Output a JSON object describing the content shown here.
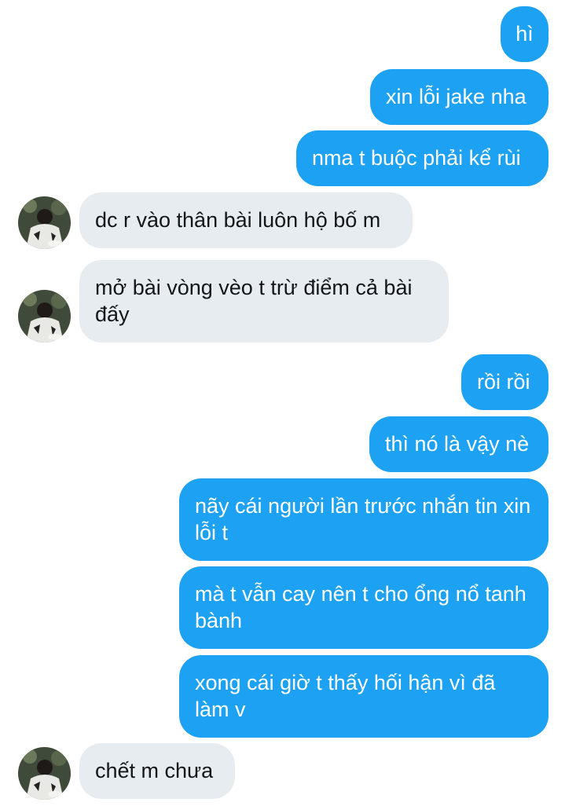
{
  "messages": [
    {
      "side": "out",
      "text": "hì"
    },
    {
      "side": "out",
      "text": "xin lỗi jake nha"
    },
    {
      "side": "out",
      "text": "nma t buộc phải kể rùi"
    },
    {
      "side": "in",
      "text": "dc r vào thân bài luôn hộ bố m"
    },
    {
      "side": "in",
      "text": "mở bài vòng vèo t trừ điểm cả bài đấy"
    },
    {
      "side": "out",
      "text": "rồi rồi"
    },
    {
      "side": "out",
      "text": "thì nó là vậy nè"
    },
    {
      "side": "out",
      "text": "nãy cái người lần trước nhắn tin xin lỗi t"
    },
    {
      "side": "out",
      "text": "mà t vẫn cay nên t cho ổng nổ tanh bành"
    },
    {
      "side": "out",
      "text": "xong cái giờ t thấy hối hận vì đã làm v"
    },
    {
      "side": "in",
      "text": "chết m chưa"
    }
  ],
  "colors": {
    "outgoing_bubble": "#1da1f2",
    "incoming_bubble": "#e6ecf0",
    "outgoing_text": "#ffffff",
    "incoming_text": "#14171a"
  },
  "icons": {
    "contact_avatar": "avatar-photo"
  }
}
